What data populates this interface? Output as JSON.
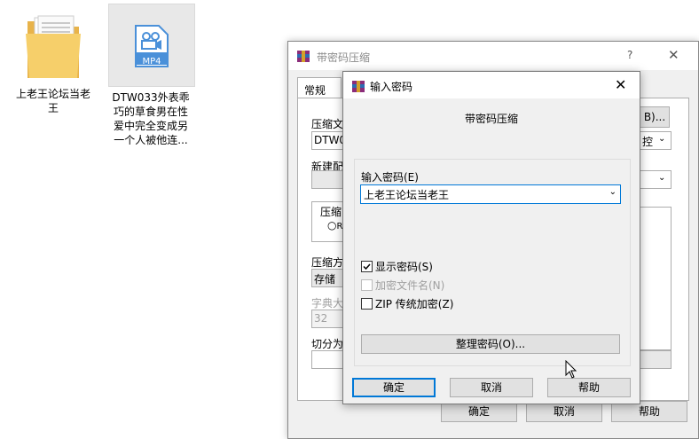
{
  "desktop": {
    "folder_label": "上老王论坛当老王",
    "mp4_badge": "MP4",
    "mp4_label": "DTW033外表乖巧的草食男在性爱中完全变成另一个人被他连..."
  },
  "bg_window": {
    "title": "带密码压缩",
    "help_glyph": "?",
    "close_glyph": "✕",
    "tab_general": "常规",
    "frag_archive_name": "压缩文",
    "frag_archive_value": "DTW03",
    "frag_browse": "B)...",
    "frag_update_combo": "控",
    "frag_new_profile": "新建配",
    "frag_format": "压缩",
    "frag_radio": "R",
    "frag_method": "压缩方",
    "frag_method_value": "存储",
    "frag_dict": "字典大",
    "frag_dict_value": "32",
    "frag_split": "切分为",
    "ok_label": "确定",
    "cancel_label": "取消",
    "help_label": "帮助"
  },
  "dialog": {
    "title": "输入密码",
    "close_glyph": "✕",
    "subtitle": "带密码压缩",
    "password_label": "输入密码(E)",
    "password_value": "上老王论坛当老王",
    "show_password_label": "显示密码(S)",
    "show_password_checked": true,
    "encrypt_names_label": "加密文件名(N)",
    "encrypt_names_checked": false,
    "zip_legacy_label": "ZIP 传统加密(Z)",
    "zip_legacy_checked": false,
    "manage_label": "整理密码(O)...",
    "ok_label": "确定",
    "cancel_label": "取消",
    "help_label": "帮助"
  },
  "colors": {
    "accent": "#0078d7",
    "dialog_bg": "#f0f0f0",
    "button_bg": "#e1e1e1",
    "border": "#adadad"
  },
  "icons": [
    "folder-icon",
    "video-file-icon",
    "winrar-icon",
    "close-icon",
    "help-icon",
    "chevron-down-icon",
    "checkmark-icon",
    "mouse-cursor-icon"
  ]
}
